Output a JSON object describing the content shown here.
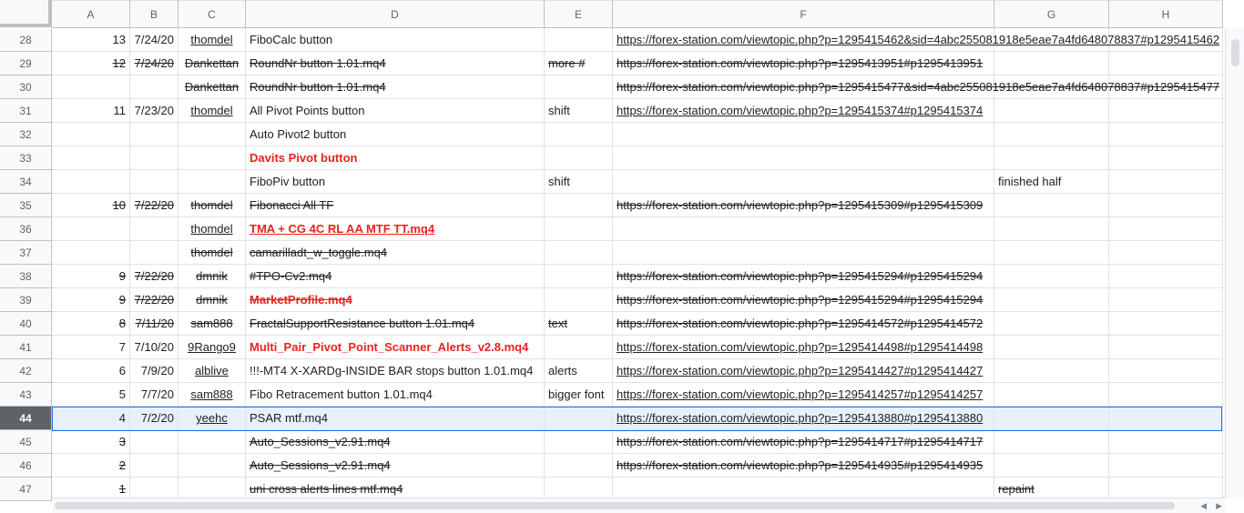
{
  "columns": [
    "A",
    "B",
    "C",
    "D",
    "E",
    "F",
    "G",
    "H"
  ],
  "rows": [
    {
      "num": "28",
      "a": "13",
      "b": "7/24/20",
      "c": "thomdel",
      "d": "FiboCalc button",
      "e": "",
      "f": "https://forex-station.com/viewtopic.php?p=1295415462&sid=4abc255081918e5eae7a4fd648078837#p1295415462",
      "g": "",
      "strike": false,
      "c_under": true,
      "d_red": false,
      "d_under": false
    },
    {
      "num": "29",
      "a": "12",
      "b": "7/24/20",
      "c": "Dankettan",
      "d": "RoundNr button 1.01.mq4",
      "e": "more #",
      "f": "https://forex-station.com/viewtopic.php?p=1295413951#p1295413951",
      "g": "",
      "strike": true,
      "c_under": false,
      "d_red": false,
      "d_under": false
    },
    {
      "num": "30",
      "a": "",
      "b": "",
      "c": "Dankettan",
      "d": "RoundNr button 1.01.mq4",
      "e": "",
      "f": "https://forex-station.com/viewtopic.php?p=1295415477&sid=4abc255081918e5eae7a4fd648078837#p1295415477",
      "g": "",
      "strike": true,
      "c_under": false,
      "d_red": false,
      "d_under": false
    },
    {
      "num": "31",
      "a": "11",
      "b": "7/23/20",
      "c": "thomdel",
      "d": "All Pivot Points button",
      "e": "shift",
      "f": "https://forex-station.com/viewtopic.php?p=1295415374#p1295415374",
      "g": "",
      "strike": false,
      "c_under": true,
      "d_red": false,
      "d_under": false
    },
    {
      "num": "32",
      "a": "",
      "b": "",
      "c": "",
      "d": "Auto Pivot2 button",
      "e": "",
      "f": "",
      "g": "",
      "strike": false,
      "c_under": false,
      "d_red": false,
      "d_under": false
    },
    {
      "num": "33",
      "a": "",
      "b": "",
      "c": "",
      "d": "Davits Pivot button",
      "e": "",
      "f": "",
      "g": "",
      "strike": false,
      "c_under": false,
      "d_red": true,
      "d_under": false
    },
    {
      "num": "34",
      "a": "",
      "b": "",
      "c": "",
      "d": "FiboPiv button",
      "e": "shift",
      "f": "",
      "g": "finished half",
      "strike": false,
      "c_under": false,
      "d_red": false,
      "d_under": false
    },
    {
      "num": "35",
      "a": "10",
      "b": "7/22/20",
      "c": "thomdel",
      "d": "Fibonacci All TF",
      "e": "",
      "f": "https://forex-station.com/viewtopic.php?p=1295415309#p1295415309",
      "g": "",
      "strike": true,
      "c_under": false,
      "d_red": false,
      "d_under": false
    },
    {
      "num": "36",
      "a": "",
      "b": "",
      "c": "thomdel",
      "d": "TMA + CG 4C RL AA MTF TT.mq4",
      "e": "",
      "f": "",
      "g": "",
      "strike": false,
      "c_under": true,
      "d_red": true,
      "d_under": true
    },
    {
      "num": "37",
      "a": "",
      "b": "",
      "c": "thomdel",
      "d": "camarilladt_w_toggle.mq4",
      "e": "",
      "f": "",
      "g": "",
      "strike": true,
      "c_under": false,
      "d_red": false,
      "d_under": false
    },
    {
      "num": "38",
      "a": "9",
      "b": "7/22/20",
      "c": "dmnik",
      "d": "#TPO-Cv2.mq4",
      "e": "",
      "f": "https://forex-station.com/viewtopic.php?p=1295415294#p1295415294",
      "g": "",
      "strike": true,
      "c_under": false,
      "d_red": false,
      "d_under": false
    },
    {
      "num": "39",
      "a": "9",
      "b": "7/22/20",
      "c": "dmnik",
      "d": "MarketProfile.mq4",
      "e": "",
      "f": "https://forex-station.com/viewtopic.php?p=1295415294#p1295415294",
      "g": "",
      "strike": true,
      "c_under": false,
      "d_red": true,
      "d_under": false
    },
    {
      "num": "40",
      "a": "8",
      "b": "7/11/20",
      "c": "sam888",
      "d": "FractalSupportResistance button 1.01.mq4",
      "e": "text",
      "f": "https://forex-station.com/viewtopic.php?p=1295414572#p1295414572",
      "g": "",
      "strike": true,
      "c_under": false,
      "d_red": false,
      "d_under": false
    },
    {
      "num": "41",
      "a": "7",
      "b": "7/10/20",
      "c": "9Rango9",
      "d": "Multi_Pair_Pivot_Point_Scanner_Alerts_v2.8.mq4",
      "e": "",
      "f": "https://forex-station.com/viewtopic.php?p=1295414498#p1295414498",
      "g": "",
      "strike": false,
      "c_under": true,
      "d_red": true,
      "d_under": false
    },
    {
      "num": "42",
      "a": "6",
      "b": "7/9/20",
      "c": "alblive",
      "d": "!!!-MT4 X-XARDg-INSIDE BAR stops button 1.01.mq4",
      "e": "alerts",
      "f": "https://forex-station.com/viewtopic.php?p=1295414427#p1295414427",
      "g": "",
      "strike": false,
      "c_under": true,
      "d_red": false,
      "d_under": false
    },
    {
      "num": "43",
      "a": "5",
      "b": "7/7/20",
      "c": "sam888",
      "d": "Fibo Retracement button 1.01.mq4",
      "e": "bigger font",
      "f": "https://forex-station.com/viewtopic.php?p=1295414257#p1295414257",
      "g": "",
      "strike": false,
      "c_under": true,
      "d_red": false,
      "d_under": false
    },
    {
      "num": "44",
      "a": "4",
      "b": "7/2/20",
      "c": "yeehc",
      "d": "PSAR mtf.mq4",
      "e": "",
      "f": "https://forex-station.com/viewtopic.php?p=1295413880#p1295413880",
      "g": "",
      "strike": false,
      "c_under": true,
      "d_red": false,
      "d_under": false,
      "selected": true
    },
    {
      "num": "45",
      "a": "3",
      "b": "",
      "c": "",
      "d": "Auto_Sessions_v2.91.mq4",
      "e": "",
      "f": "https://forex-station.com/viewtopic.php?p=1295414717#p1295414717",
      "g": "",
      "strike": true,
      "c_under": false,
      "d_red": false,
      "d_under": false
    },
    {
      "num": "46",
      "a": "2",
      "b": "",
      "c": "",
      "d": "Auto_Sessions_v2.91.mq4",
      "e": "",
      "f": "https://forex-station.com/viewtopic.php?p=1295414935#p1295414935",
      "g": "",
      "strike": true,
      "c_under": false,
      "d_red": false,
      "d_under": false
    },
    {
      "num": "47",
      "a": "1",
      "b": "",
      "c": "",
      "d": "uni cross alerts lines mtf.mq4",
      "e": "",
      "f": "",
      "g": "repaint",
      "strike": true,
      "c_under": false,
      "d_red": false,
      "d_under": false
    }
  ],
  "colors": {
    "accent": "#1a73e8",
    "red_text": "#e8231f",
    "selected_header": "#5f6368",
    "selected_fill": "#e8f0fe"
  }
}
